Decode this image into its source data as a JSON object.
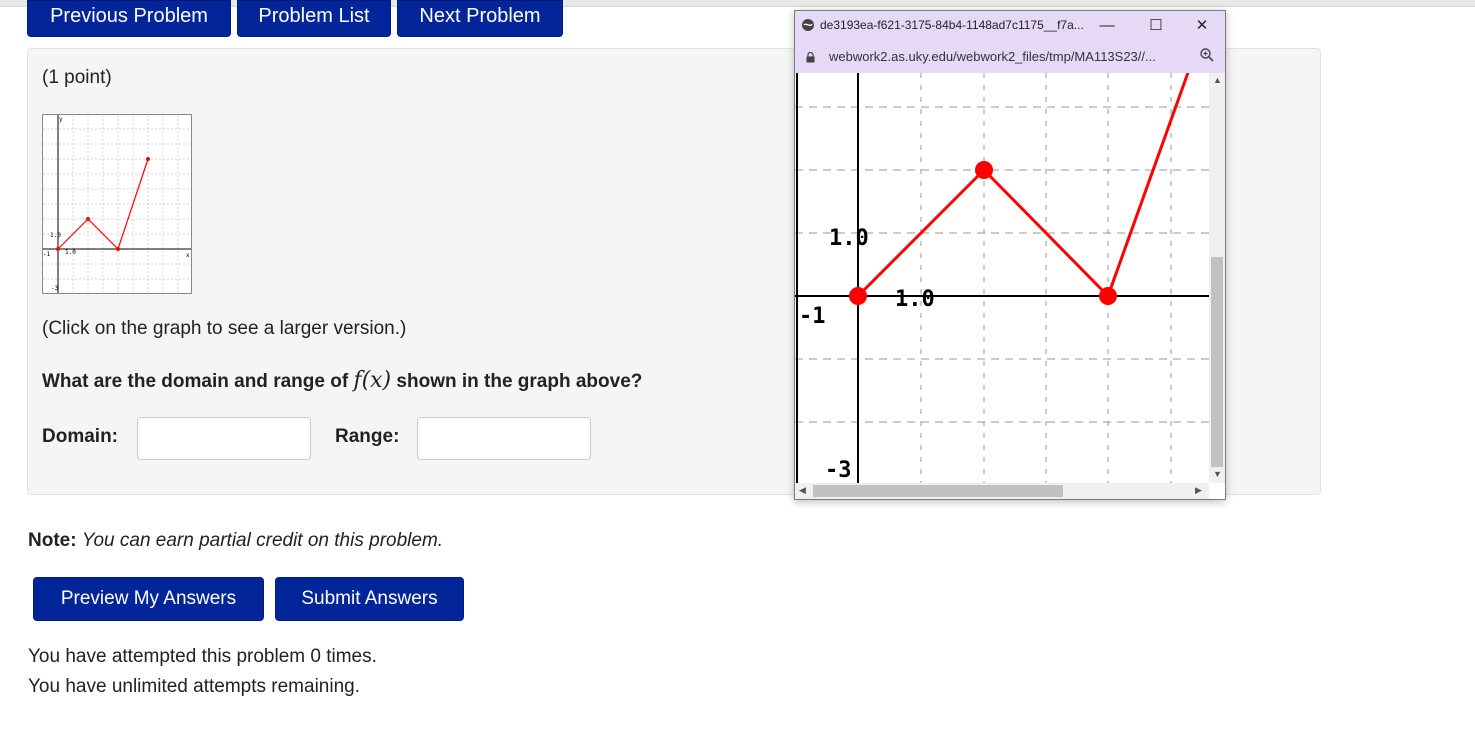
{
  "nav": {
    "previous": "Previous Problem",
    "list": "Problem List",
    "next": "Next Problem"
  },
  "problem": {
    "points": "(1 point)",
    "click_note": "(Click on the graph to see a larger version.)",
    "question_before": "What are the domain and range of ",
    "question_math": "f(x)",
    "question_after": " shown in the graph above?",
    "domain_label": "Domain:",
    "domain_value": "",
    "range_label": "Range:",
    "range_value": ""
  },
  "note": {
    "label": "Note:",
    "text": "You can earn partial credit on this problem."
  },
  "actions": {
    "preview": "Preview My Answers",
    "submit": "Submit Answers"
  },
  "attempts": {
    "line1": "You have attempted this problem 0 times.",
    "line2": "You have unlimited attempts remaining."
  },
  "popup": {
    "title": "de3193ea-f621-3175-84b4-1148ad7c1175__f7a...",
    "url": "webwork2.as.uky.edu/webwork2_files/tmp/MA113S23//...",
    "minimize": "—",
    "maximize": "☐",
    "close": "✕"
  },
  "graph": {
    "tick_y": "1.0",
    "tick_x": "1.0",
    "xmin_label": "-1",
    "ymin_label": "-3",
    "x_axis_label": "x",
    "y_axis_label": "y"
  },
  "colors": {
    "button_blue": "#03259a",
    "graph_red": "#ff0000",
    "popup_chrome": "#e6d9f6"
  }
}
